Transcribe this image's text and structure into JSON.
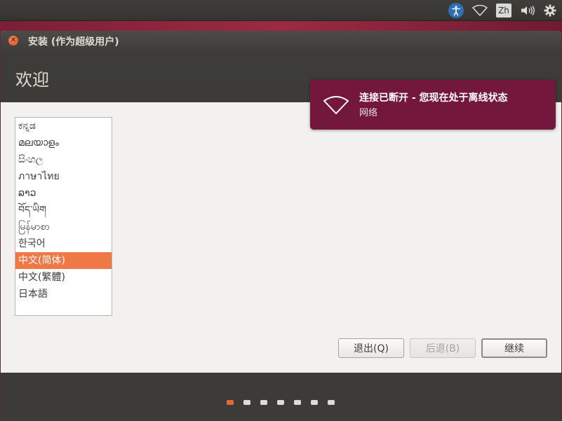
{
  "top_panel": {
    "icons": [
      "accessibility-icon",
      "wifi-icon",
      "keyboard-layout-indicator",
      "volume-icon",
      "gear-icon"
    ],
    "keyboard_indicator": "Zh"
  },
  "window": {
    "title": "安装 (作为超级用户)",
    "heading": "欢迎"
  },
  "language_list": {
    "items": [
      {
        "label": "ಕನ್ನಡ"
      },
      {
        "label": "മലയാളം"
      },
      {
        "label": "සිංහල"
      },
      {
        "label": "ภาษาไทย"
      },
      {
        "label": "ລາວ"
      },
      {
        "label": "བོད་ཡིག"
      },
      {
        "label": "မြန်မာစာ"
      },
      {
        "label": "한국어"
      },
      {
        "label": "中文(简体)"
      },
      {
        "label": "中文(繁體)"
      },
      {
        "label": "日本語"
      }
    ],
    "selected_index": 8
  },
  "buttons": {
    "quit": "退出(Q)",
    "back": "后退(B)",
    "continue": "继续"
  },
  "progress": {
    "steps_total": 7,
    "current_step": 1
  },
  "notification": {
    "title": "连接已断开 - 您现在处于离线状态",
    "body": "网络"
  },
  "colors": {
    "accent_selected": "#f07746",
    "notification_bg": "#74173d",
    "active_dot": "#e0683c"
  }
}
